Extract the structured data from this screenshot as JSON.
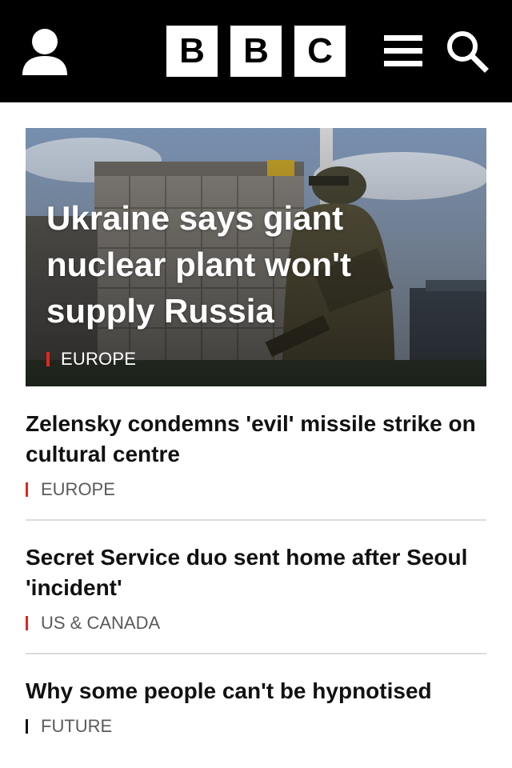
{
  "header": {
    "logo_letters": [
      "B",
      "B",
      "C"
    ],
    "icons": [
      "account-icon",
      "menu-icon",
      "search-icon"
    ]
  },
  "hero": {
    "headline": "Ukraine says giant nuclear plant won't supply Russia",
    "section": "EUROPE",
    "section_color": "#e5241b"
  },
  "stories": [
    {
      "title": "Zelensky condemns 'evil' missile strike on cultural centre",
      "section": "EUROPE",
      "section_color": "#e5241b"
    },
    {
      "title": "Secret Service duo sent home after Seoul 'incident'",
      "section": "US & CANADA",
      "section_color": "#e5241b"
    },
    {
      "title": "Why some people can't be hypnotised",
      "section": "FUTURE",
      "section_color": "#111111"
    }
  ],
  "colors": {
    "header_bg": "#000000",
    "accent_red": "#e5241b"
  }
}
